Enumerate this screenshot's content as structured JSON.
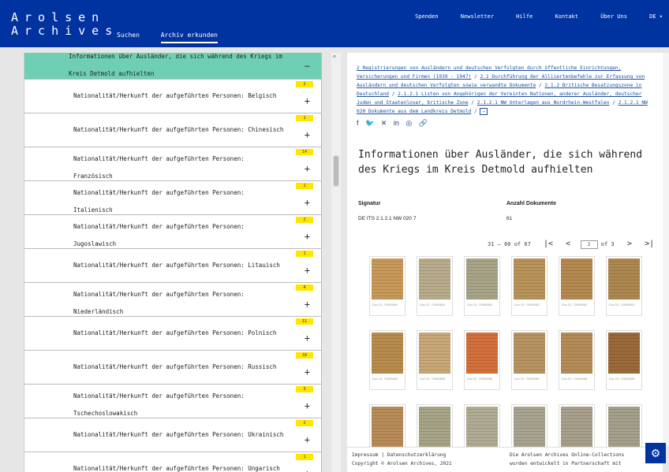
{
  "header": {
    "logo_line1": "Arolsen",
    "logo_line2": "Archives",
    "nav_left": [
      "Suchen",
      "Archiv erkunden"
    ],
    "nav_right": [
      "Spenden",
      "Newsletter",
      "Hilfe",
      "Kontakt",
      "Über Uns",
      "DE ▾"
    ]
  },
  "tree": {
    "active": {
      "line1": "Informationen über Ausländer, die sich während des Kriegs im",
      "line2": "Kreis Detmold aufhielten",
      "icon": "−"
    },
    "items": [
      {
        "line1": "Nationalität/Herkunft der aufgeführten Personen: Belgisch",
        "line2": "",
        "count": "2"
      },
      {
        "line1": "Nationalität/Herkunft der aufgeführten Personen: Chinesisch",
        "line2": "",
        "count": "1"
      },
      {
        "line1": "Nationalität/Herkunft der aufgeführten Personen:",
        "line2": "Französisch",
        "count": "14"
      },
      {
        "line1": "Nationalität/Herkunft der aufgeführten Personen:",
        "line2": "Italienisch",
        "count": "1"
      },
      {
        "line1": "Nationalität/Herkunft der aufgeführten Personen:",
        "line2": "Jugoslawisch",
        "count": "2"
      },
      {
        "line1": "Nationalität/Herkunft der aufgeführten Personen: Litauisch",
        "line2": "",
        "count": "1"
      },
      {
        "line1": "Nationalität/Herkunft der aufgeführten Personen:",
        "line2": "Niederländisch",
        "count": "4"
      },
      {
        "line1": "Nationalität/Herkunft der aufgeführten Personen: Polnisch",
        "line2": "",
        "count": "11"
      },
      {
        "line1": "Nationalität/Herkunft der aufgeführten Personen: Russisch",
        "line2": "",
        "count": "18"
      },
      {
        "line1": "Nationalität/Herkunft der aufgeführten Personen:",
        "line2": "Tschechoslowakisch",
        "count": "3"
      },
      {
        "line1": "Nationalität/Herkunft der aufgeführten Personen: Ukrainisch",
        "line2": "",
        "count": "2"
      },
      {
        "line1": "Nationalität/Herkunft der aufgeführten Personen: Ungarisch",
        "line2": "",
        "count": "1"
      }
    ]
  },
  "breadcrumb": [
    "2 Registrierungen von Ausländern und deutschen Verfolgten durch öffentliche Einrichtungen, Versicherungen und Firmen (1939 - 1947)",
    "2.1 Durchführung der Alliiertenbefehle zur Erfassung von Ausländern und deutschen Verfolgten sowie verwandte Dokumente",
    "2.1.2 Britische Besatzungszone in Deutschland",
    "2.1.2.1 Listen von Angehörigen der Vereinten Nationen, anderer Ausländer, deutscher Juden und Staatenloser, britische Zone",
    "2.1.2.1 NW Unterlagen aus Nordrhein-Westfalen",
    "2.1.2.1 NW 020 Dokumente aus dem Landkreis Detmold"
  ],
  "breadcrumb_end": "−",
  "social": [
    "f",
    "🐦",
    "✕",
    "in",
    "◎",
    "🔗"
  ],
  "detail": {
    "title": "Informationen über Ausländer, die sich während des Kriegs im Kreis Detmold aufhielten",
    "signatur_label": "Signatur",
    "signatur_value": "DE ITS 2.1.2.1 NW 020 7",
    "anzahl_label": "Anzahl Dokumente",
    "anzahl_value": "61"
  },
  "pager": {
    "range": "31 – 60 of 67",
    "page": "2",
    "of": "of 3"
  },
  "docs": [
    {
      "id": "Doc ID: 70596849",
      "color": "#c89a5a"
    },
    {
      "id": "Doc ID: 70596850",
      "color": "#b8ac8c"
    },
    {
      "id": "Doc ID: 70596850",
      "color": "#a8a488"
    },
    {
      "id": "Doc ID: 70596851",
      "color": "#b8945a"
    },
    {
      "id": "Doc ID: 70596852",
      "color": "#b48a50"
    },
    {
      "id": "Doc ID: 70596853",
      "color": "#ac8850"
    },
    {
      "id": "Doc ID: 70596854",
      "color": "#b88c4c"
    },
    {
      "id": "Doc ID: 70596855",
      "color": "#c8a878"
    },
    {
      "id": "Doc ID: 70596856",
      "color": "#d4703c"
    },
    {
      "id": "Doc ID: 70596857",
      "color": "#b89462"
    },
    {
      "id": "Doc ID: 70596858",
      "color": "#b48c58"
    },
    {
      "id": "Doc ID: 70596859",
      "color": "#9a6a3a"
    },
    {
      "id": "",
      "color": "#b88c58"
    },
    {
      "id": "",
      "color": "#a8a488"
    },
    {
      "id": "",
      "color": "#b0ac94"
    },
    {
      "id": "",
      "color": "#a8a490"
    },
    {
      "id": "",
      "color": "#a8a08c"
    },
    {
      "id": "",
      "color": "#a4a08c"
    }
  ],
  "footer": {
    "impressum": "Impressum",
    "sep": "|",
    "datenschutz": "Datenschutzerklärung",
    "copyright": "Copyright © Arolsen Archives, 2021",
    "right1": "Die Arolsen Archives Online-Collections",
    "right2": "wurden entwickelt in Partnerschaft mit"
  },
  "colors": {
    "brand": "#0033a0",
    "active_row": "#6fcfb4",
    "badge": "#ffe600",
    "link": "#1a4fa0"
  }
}
